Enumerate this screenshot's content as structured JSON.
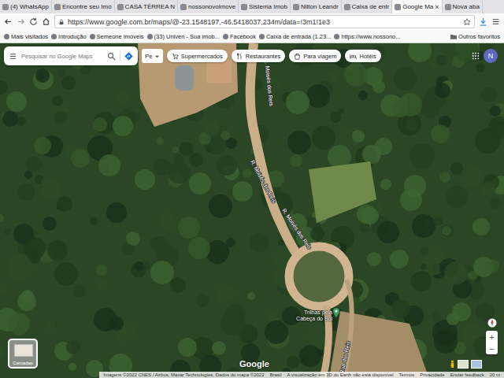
{
  "tabs": [
    {
      "label": "(4) WhatsApp",
      "selected": false
    },
    {
      "label": "Encontre seu Imó",
      "selected": false
    },
    {
      "label": "CASA TÉRREA N",
      "selected": false
    },
    {
      "label": "nossonovoimove",
      "selected": false
    },
    {
      "label": "Sistema Imob",
      "selected": false
    },
    {
      "label": "Nilton Leandr",
      "selected": false
    },
    {
      "label": "Caixa de entr",
      "selected": false
    },
    {
      "label": "Google Ma",
      "selected": true
    },
    {
      "label": "Nova aba",
      "selected": false
    }
  ],
  "tab_close": "×",
  "address_bar": {
    "url": "https://www.google.com.br/maps/@-23.1548197,-46.5418037,234m/data=!3m1!1e3"
  },
  "bookmarks": {
    "items": [
      "Mais visitados",
      "Introdução",
      "Semeone Imóveis",
      "(33) Univen - Sua imob...",
      "Facebook",
      "Caixa de entrada (1.23...",
      "https://www.nossono..."
    ],
    "other": "Outros favoritos"
  },
  "maps": {
    "search_placeholder": "Pesquisar no Google Maps",
    "mode": "Pe",
    "chips": [
      "Supermercados",
      "Restaurantes",
      "Para viagem",
      "Hotéis"
    ],
    "account_initial": "N",
    "road_labels": [
      "R. Moisés dos Reis",
      "R. Moisés dos Reis",
      "R. Moisés dos Reis",
      "Rua dos Reis"
    ],
    "place": "Trilhas pela Cabeça do Boi",
    "layers_button": "Camadas",
    "logo": "Google",
    "footer": [
      "Imagens ©2022 CNES / Airbus, Maxar Technologies, Dados do mapa ©2022",
      "Brasil",
      "A visualização em 3D do Earth não está disponível",
      "Termos",
      "Privacidade",
      "Enviar feedback",
      "20 m"
    ],
    "zoom_in": "+",
    "zoom_out": "−"
  }
}
